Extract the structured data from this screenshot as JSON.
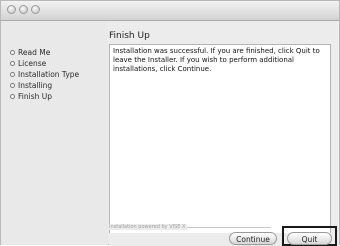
{
  "window": {
    "title": ""
  },
  "sidebar": {
    "steps": [
      {
        "label": "Read Me"
      },
      {
        "label": "License"
      },
      {
        "label": "Installation Type"
      },
      {
        "label": "Installing"
      },
      {
        "label": "Finish Up"
      }
    ]
  },
  "main": {
    "heading": "Finish Up",
    "message": "Installation was successful. If you are finished, click Quit to leave the Installer. If you wish to perform additional installations, click Continue."
  },
  "footer": {
    "powered_by": "Installation powered by VISE X"
  },
  "buttons": {
    "continue_label": "Continue",
    "quit_label": "Quit"
  }
}
